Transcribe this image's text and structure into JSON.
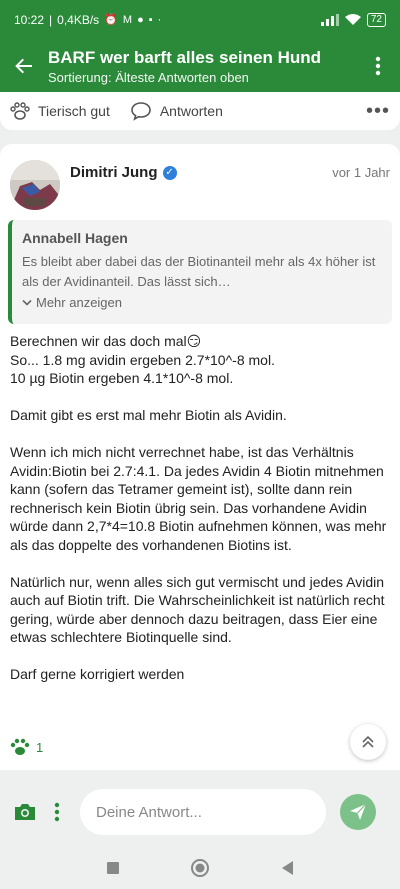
{
  "status_bar": {
    "time": "10:22",
    "speed": "0,4KB/s",
    "battery": "72"
  },
  "header": {
    "title": "BARF wer barft alles seinen Hund",
    "subtitle": "Sortierung: Älteste Antworten oben"
  },
  "previous_post": {
    "reaction_label": "Tierisch gut",
    "reply_label": "Antworten"
  },
  "post": {
    "author": "Dimitri Jung",
    "time": "vor 1 Jahr",
    "quote": {
      "author": "Annabell Hagen",
      "text": "Es bleibt aber dabei das der Biotinanteil mehr als 4x höher ist als der Avidinanteil. Das lässt sich…",
      "more_label": "Mehr anzeigen"
    },
    "paragraphs": [
      [
        "Berechnen wir das doch mal😏",
        "So... 1.8 mg avidin ergeben 2.7*10^-8 mol.",
        "10 µg Biotin ergeben 4.1*10^-8 mol."
      ],
      [
        "Damit gibt es erst mal mehr Biotin als Avidin."
      ],
      [
        "Wenn ich mich nicht verrechnet habe, ist das Verhältnis Avidin:Biotin bei 2.7:4.1. Da jedes Avidin 4 Biotin mitnehmen kann (sofern das Tetramer gemeint ist), sollte dann rein rechnerisch kein Biotin übrig sein. Das vorhandene Avidin würde dann 2,7*4=10.8 Biotin aufnehmen können, was mehr als das doppelte des vorhandenen Biotins ist."
      ],
      [
        "Natürlich nur, wenn alles sich gut vermischt und jedes Avidin auch auf Biotin trift. Die Wahrscheinlichkeit ist natürlich recht gering, würde aber dennoch dazu beitragen, dass Eier eine etwas schlechtere Biotinquelle sind."
      ],
      [
        "Darf gerne korrigiert werden"
      ]
    ],
    "reaction_count": "1"
  },
  "compose": {
    "placeholder": "Deine Antwort..."
  },
  "colors": {
    "accent": "#2b8a3a",
    "send_button": "#7cc08a",
    "verified": "#2f7fdc"
  }
}
